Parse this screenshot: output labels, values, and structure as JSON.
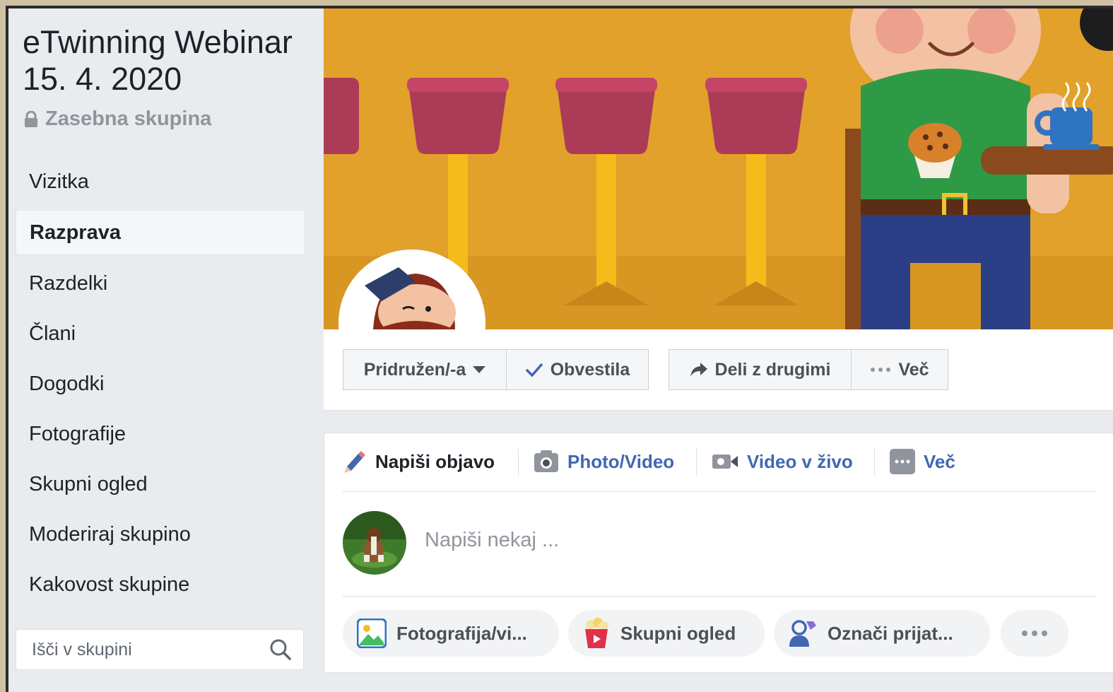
{
  "group": {
    "title_line1": "eTwinning Webinar",
    "title_line2": "15. 4. 2020",
    "privacy": "Zasebna skupina"
  },
  "sidebar": {
    "items": [
      {
        "label": "Vizitka"
      },
      {
        "label": "Razprava",
        "active": true
      },
      {
        "label": "Razdelki"
      },
      {
        "label": "Člani"
      },
      {
        "label": "Dogodki"
      },
      {
        "label": "Fotografije"
      },
      {
        "label": "Skupni ogled"
      },
      {
        "label": "Moderiraj skupino"
      },
      {
        "label": "Kakovost skupine"
      }
    ],
    "search_placeholder": "Išči v skupini"
  },
  "actions": {
    "joined": "Pridružen/-a",
    "notifications": "Obvestila",
    "share": "Deli z drugimi",
    "more": "Več"
  },
  "composer": {
    "tabs": {
      "write": "Napiši objavo",
      "photo_video": "Photo/Video",
      "live": "Video v živo",
      "more": "Več"
    },
    "placeholder": "Napiši nekaj ...",
    "pills": {
      "photo": "Fotografija/vi...",
      "watch": "Skupni ogled",
      "tag": "Označi prijat..."
    }
  },
  "colors": {
    "link_blue": "#4267b2",
    "cover_bg": "#e1a12a",
    "stool_seat": "#ac3b57",
    "stool_leg": "#f5bb1a"
  }
}
